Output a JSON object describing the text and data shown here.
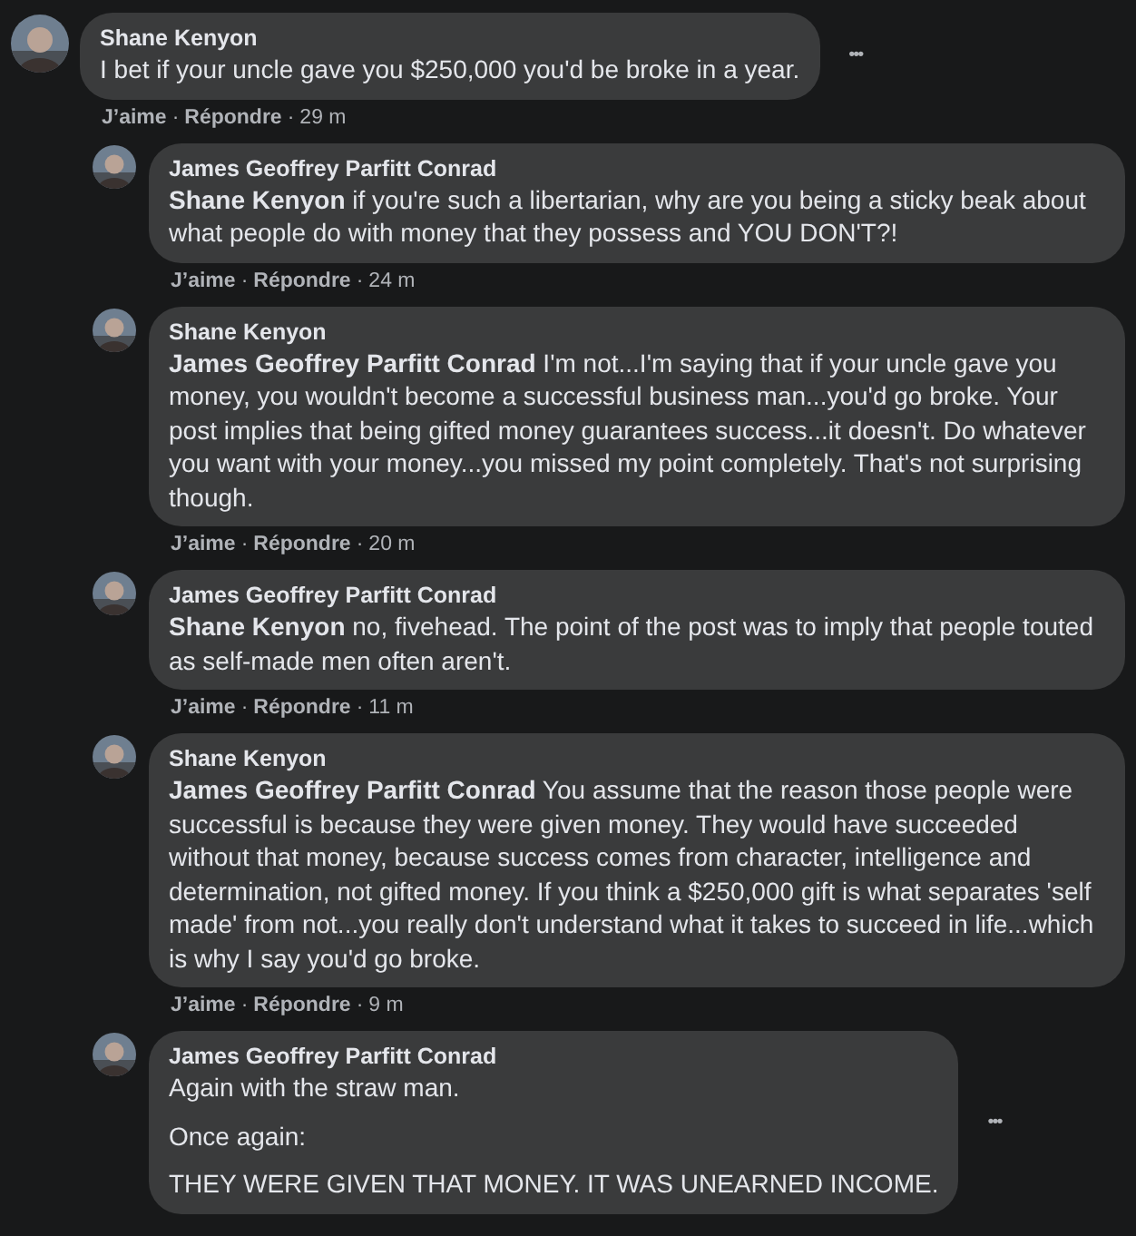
{
  "comment": {
    "author": "Shane Kenyon",
    "paragraphs": [
      "I bet if your uncle gave you $250,000 you'd be broke in a year."
    ],
    "more": "•••",
    "actions": [
      "J’aime",
      "·",
      "Répondre",
      "·",
      "29 m"
    ],
    "replies": [
      {
        "author": "James Geoffrey Parfitt Conrad",
        "paragraphs": [
          "**Shane Kenyon** if you're such a libertarian, why are you being a sticky beak about what people do with money that they possess and YOU DON'T?!"
        ],
        "actions": [
          "J’aime",
          "·",
          "Répondre",
          "·",
          "24 m"
        ]
      },
      {
        "author": "Shane Kenyon",
        "paragraphs": [
          "**James Geoffrey Parfitt Conrad** I'm not...I'm saying that if your uncle gave you money, you wouldn't become a successful business man...you'd go broke. Your post implies that being gifted money guarantees success...it doesn't. Do whatever you want with your money...you missed my point completely. That's not surprising though."
        ],
        "actions": [
          "J’aime",
          "·",
          "Répondre",
          "·",
          "20 m"
        ]
      },
      {
        "author": "James Geoffrey Parfitt Conrad",
        "paragraphs": [
          "**Shane Kenyon** no, fivehead. The point of the post was to imply that people touted as self-made men often aren't."
        ],
        "actions": [
          "J’aime",
          "·",
          "Répondre",
          "·",
          "11 m"
        ]
      },
      {
        "author": "Shane Kenyon",
        "paragraphs": [
          "**James Geoffrey Parfitt Conrad** You assume that the reason those people were successful is because they were given money. They would have succeeded without that money, because success comes from character, intelligence and determination, not gifted money. If you think a $250,000 gift is what separates 'self made' from not...you really don't understand what it takes to succeed in life...which is why I say you'd go broke."
        ],
        "actions": [
          "J’aime",
          "·",
          "Répondre",
          "·",
          "9 m"
        ]
      },
      {
        "author": "James Geoffrey Parfitt Conrad",
        "paragraphs": [
          "Again with the straw man.",
          "Once again:",
          "THEY WERE GIVEN THAT MONEY. IT WAS UNEARNED INCOME."
        ],
        "more": "•••"
      }
    ]
  }
}
